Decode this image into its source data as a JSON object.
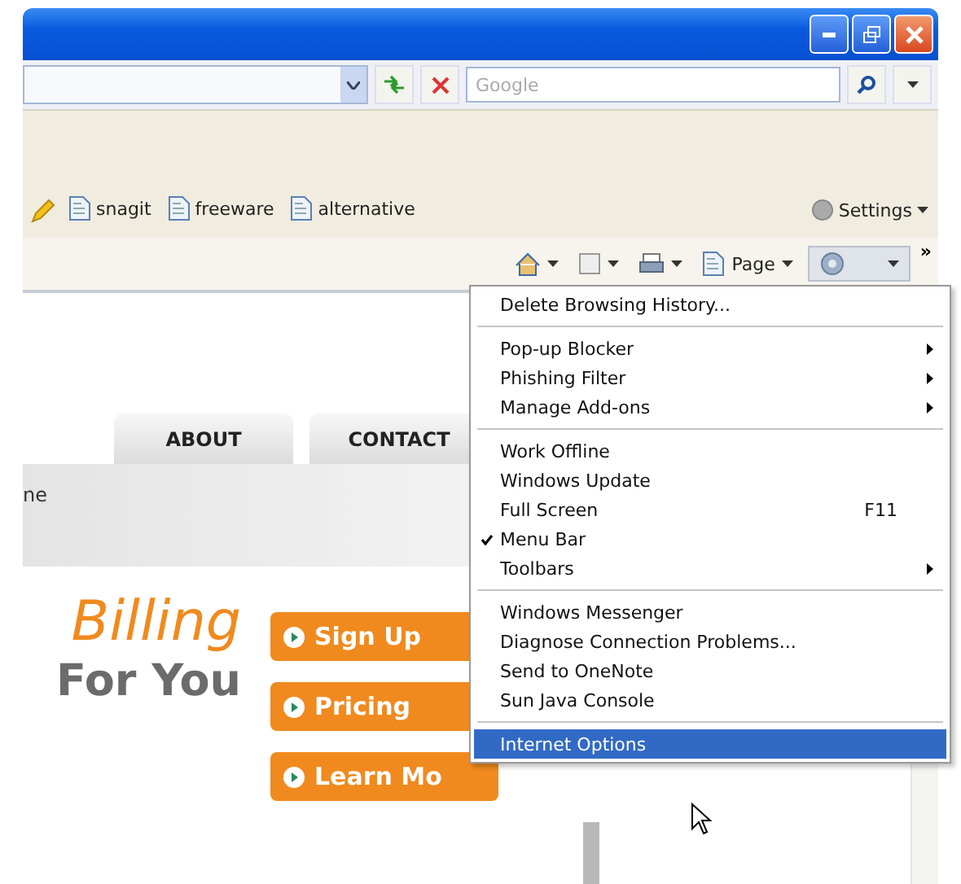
{
  "search": {
    "placeholder": "Google"
  },
  "links": [
    {
      "label": "snagit"
    },
    {
      "label": "freeware"
    },
    {
      "label": "alternative"
    }
  ],
  "settings": {
    "label": "Settings"
  },
  "command_bar": {
    "page_label": "Page",
    "overflow": "»"
  },
  "page": {
    "tabs": [
      "ABOUT",
      "CONTACT"
    ],
    "banner_text": "ne",
    "headline": "Billing",
    "subhead": "For You",
    "buttons": [
      "Sign Up",
      "Pricing",
      "Learn Mo"
    ]
  },
  "menu": [
    {
      "kind": "item",
      "label": "Delete Browsing History...",
      "submenu": false,
      "checked": false,
      "selected": false
    },
    {
      "kind": "separator"
    },
    {
      "kind": "item",
      "label": "Pop-up Blocker",
      "submenu": true,
      "checked": false,
      "selected": false
    },
    {
      "kind": "item",
      "label": "Phishing Filter",
      "submenu": true,
      "checked": false,
      "selected": false
    },
    {
      "kind": "item",
      "label": "Manage Add-ons",
      "submenu": true,
      "checked": false,
      "selected": false
    },
    {
      "kind": "separator"
    },
    {
      "kind": "item",
      "label": "Work Offline",
      "submenu": false,
      "checked": false,
      "selected": false
    },
    {
      "kind": "item",
      "label": "Windows Update",
      "submenu": false,
      "checked": false,
      "selected": false
    },
    {
      "kind": "item",
      "label": "Full Screen",
      "shortcut": "F11",
      "submenu": false,
      "checked": false,
      "selected": false
    },
    {
      "kind": "item",
      "label": "Menu Bar",
      "submenu": false,
      "checked": true,
      "selected": false
    },
    {
      "kind": "item",
      "label": "Toolbars",
      "submenu": true,
      "checked": false,
      "selected": false
    },
    {
      "kind": "separator"
    },
    {
      "kind": "item",
      "label": "Windows Messenger",
      "submenu": false,
      "checked": false,
      "selected": false
    },
    {
      "kind": "item",
      "label": "Diagnose Connection Problems...",
      "submenu": false,
      "checked": false,
      "selected": false
    },
    {
      "kind": "item",
      "label": "Send to OneNote",
      "submenu": false,
      "checked": false,
      "selected": false
    },
    {
      "kind": "item",
      "label": "Sun Java Console",
      "submenu": false,
      "checked": false,
      "selected": false
    },
    {
      "kind": "separator"
    },
    {
      "kind": "item",
      "label": "Internet Options",
      "submenu": false,
      "checked": false,
      "selected": true
    }
  ]
}
